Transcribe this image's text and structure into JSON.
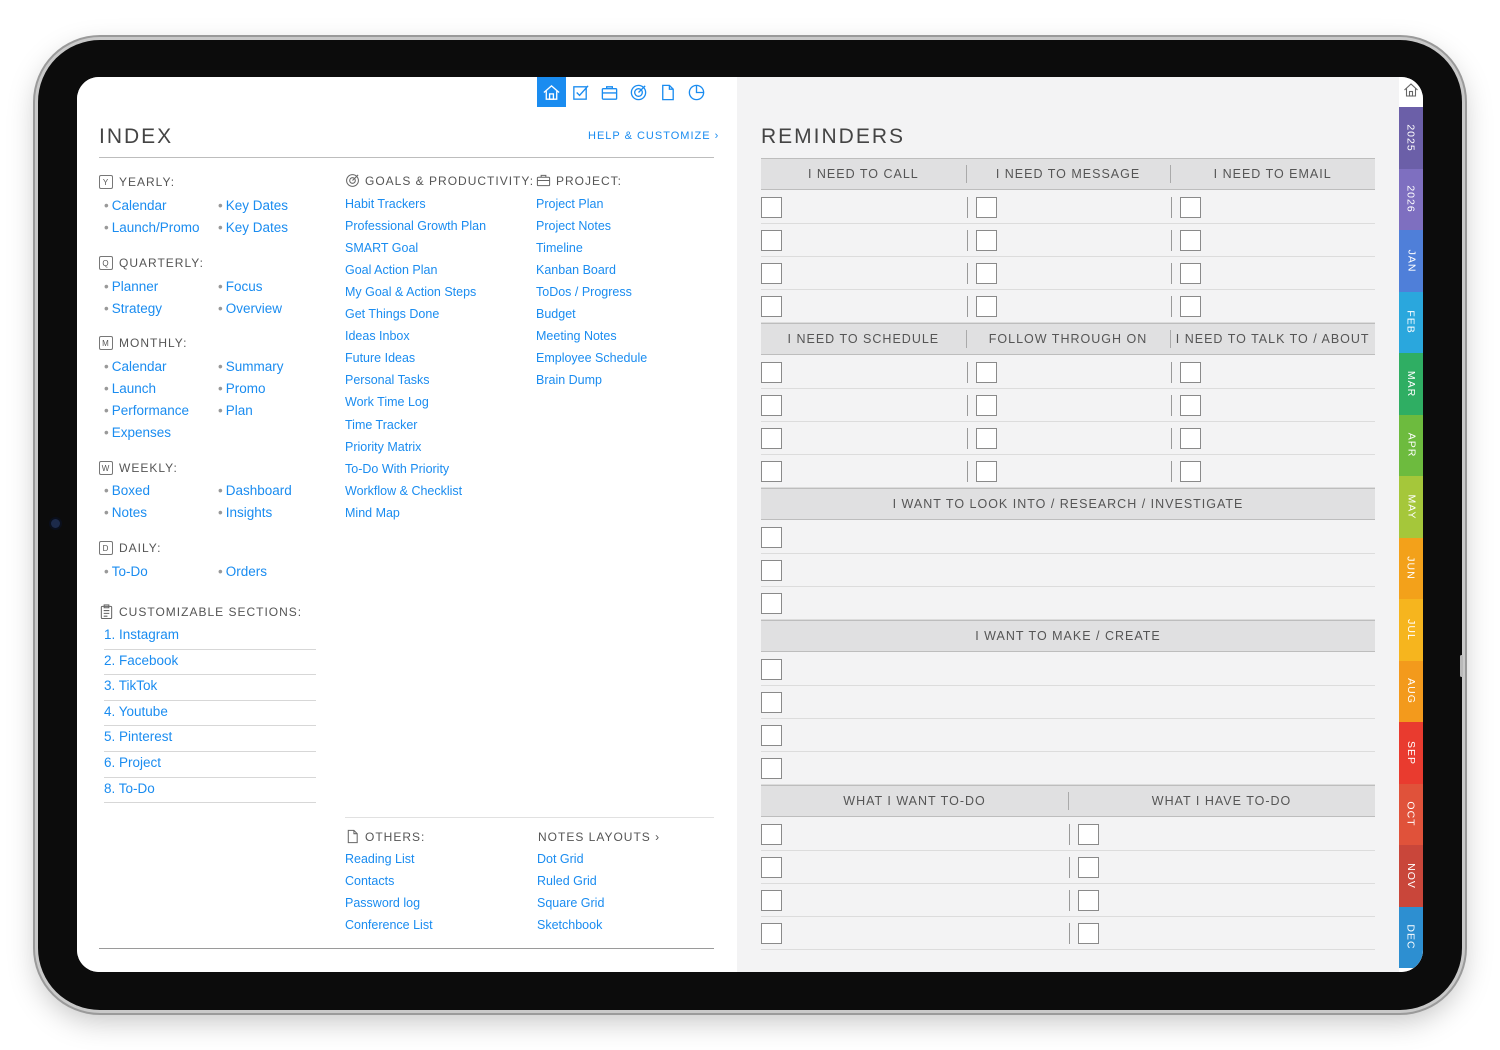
{
  "index": {
    "title": "INDEX",
    "help": "HELP & CUSTOMIZE ›",
    "yearly": {
      "label": "YEARLY:",
      "icon_letter": "Y",
      "items": [
        "Calendar",
        "Key Dates",
        "Launch/Promo",
        "Key Dates"
      ]
    },
    "quarterly": {
      "label": "QUARTERLY:",
      "icon_letter": "Q",
      "items": [
        "Planner",
        "Focus",
        "Strategy",
        "Overview"
      ]
    },
    "monthly": {
      "label": "MONTHLY:",
      "icon_letter": "M",
      "items": [
        "Calendar",
        "Summary",
        "Launch",
        "Promo",
        "Performance",
        "Plan",
        "Expenses"
      ]
    },
    "weekly": {
      "label": "WEEKLY:",
      "icon_letter": "W",
      "items": [
        "Boxed",
        "Dashboard",
        "Notes",
        "Insights"
      ]
    },
    "daily": {
      "label": "DAILY:",
      "icon_letter": "D",
      "items": [
        "To-Do",
        "Orders"
      ]
    },
    "customizable": {
      "label": "CUSTOMIZABLE SECTIONS:",
      "items": [
        "1. Instagram",
        "2. Facebook",
        "3. TikTok",
        "4. Youtube",
        "5. Pinterest",
        "6. Project",
        "8. To-Do"
      ]
    },
    "goals": {
      "label": "GOALS & PRODUCTIVITY:",
      "items": [
        "Habit Trackers",
        "Professional Growth Plan",
        "SMART Goal",
        "Goal Action Plan",
        "My Goal & Action Steps",
        "Get Things Done",
        "Ideas Inbox",
        "Future Ideas",
        "Personal Tasks",
        "Work Time Log",
        "Time Tracker",
        "Priority Matrix",
        "To-Do With Priority",
        "Workflow & Checklist",
        "Mind Map"
      ]
    },
    "project": {
      "label": "PROJECT:",
      "items": [
        "Project Plan",
        "Project Notes",
        "Timeline",
        "Kanban Board",
        "ToDos / Progress",
        "Budget",
        "Meeting Notes",
        "Employee Schedule",
        "Brain Dump"
      ]
    },
    "others": {
      "label": "OTHERS:",
      "items": [
        "Reading List",
        "Contacts",
        "Password log",
        "Conference List"
      ]
    },
    "notes_layouts": {
      "label": "NOTES LAYOUTS ›",
      "items": [
        "Dot Grid",
        "Ruled Grid",
        "Square Grid",
        "Sketchbook"
      ]
    }
  },
  "reminders": {
    "title": "REMINDERS",
    "headers_1": [
      "I NEED TO CALL",
      "I NEED TO MESSAGE",
      "I NEED TO EMAIL"
    ],
    "headers_2": [
      "I NEED TO SCHEDULE",
      "FOLLOW THROUGH ON",
      "I NEED TO TALK TO / ABOUT"
    ],
    "header_3": "I WANT TO LOOK INTO / RESEARCH / INVESTIGATE",
    "header_4": "I WANT TO MAKE / CREATE",
    "headers_5": [
      "WHAT I WANT TO-DO",
      "WHAT I HAVE TO-DO"
    ]
  },
  "top_icons": [
    "home-icon",
    "checkbox-icon",
    "briefcase-icon",
    "goal-icon",
    "document-icon",
    "pie-chart-icon"
  ],
  "tabs": [
    {
      "label": "2025",
      "color": "#6b5fa8"
    },
    {
      "label": "2026",
      "color": "#7e6fc0"
    },
    {
      "label": "JAN",
      "color": "#4f7fd9"
    },
    {
      "label": "FEB",
      "color": "#2aa7dd"
    },
    {
      "label": "MAR",
      "color": "#2fae63"
    },
    {
      "label": "APR",
      "color": "#6dbb3e"
    },
    {
      "label": "MAY",
      "color": "#a5c73a"
    },
    {
      "label": "JUN",
      "color": "#f3a11a"
    },
    {
      "label": "JUL",
      "color": "#f6b51e"
    },
    {
      "label": "AUG",
      "color": "#f39a1c"
    },
    {
      "label": "SEP",
      "color": "#e93b2f"
    },
    {
      "label": "OCT",
      "color": "#e0523a"
    },
    {
      "label": "NOV",
      "color": "#c9463a"
    },
    {
      "label": "DEC",
      "color": "#2d8fd1"
    }
  ],
  "colors": {
    "accent": "#1a8cf0"
  }
}
